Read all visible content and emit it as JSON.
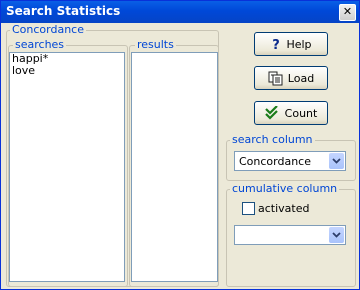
{
  "window": {
    "title": "Search Statistics",
    "close_glyph": "✕"
  },
  "concordance_group": {
    "label": "Concordance"
  },
  "searches": {
    "label": "searches",
    "items": [
      "happi*",
      "love"
    ]
  },
  "results": {
    "label": "results",
    "items": []
  },
  "buttons": {
    "help": "Help",
    "load": "Load",
    "count": "Count"
  },
  "search_column": {
    "label": "search column",
    "selected": "Concordance"
  },
  "cumulative_column": {
    "label": "cumulative column",
    "checkbox_label": "activated",
    "checked": false,
    "selected": ""
  },
  "icons": {
    "help": "question-mark-icon",
    "load": "load-document-icon",
    "count": "double-checkmark-icon",
    "dropdown": "chevron-down-icon"
  },
  "colors": {
    "accent_label": "#0046d5",
    "title_bar": "#0048d8",
    "count_icon": "#1a7c1a"
  }
}
